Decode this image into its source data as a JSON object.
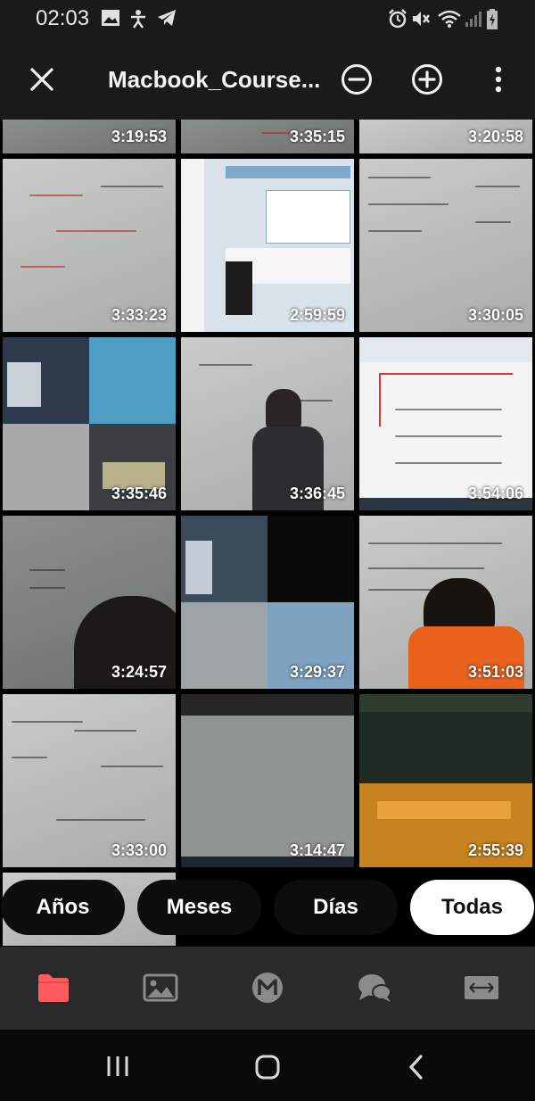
{
  "status_bar": {
    "time": "02:03",
    "left_icons": [
      "gallery-icon",
      "accessibility-icon",
      "telegram-icon"
    ],
    "right_icons": [
      "alarm-icon",
      "mute-icon",
      "wifi-icon",
      "signal-icon",
      "battery-charging-icon"
    ]
  },
  "app_bar": {
    "title": "Macbook_Course..."
  },
  "thumbnails": [
    {
      "duration": "3:19:53"
    },
    {
      "duration": "3:35:15"
    },
    {
      "duration": "3:20:58"
    },
    {
      "duration": "3:33:23"
    },
    {
      "duration": "2:59:59"
    },
    {
      "duration": "3:30:05"
    },
    {
      "duration": "3:35:46"
    },
    {
      "duration": "3:36:45"
    },
    {
      "duration": "3:54:06"
    },
    {
      "duration": "3:24:57"
    },
    {
      "duration": "3:29:37"
    },
    {
      "duration": "3:51:03"
    },
    {
      "duration": "3:33:00"
    },
    {
      "duration": "3:14:47"
    },
    {
      "duration": "2:55:39"
    }
  ],
  "filters": {
    "years": "Años",
    "months": "Meses",
    "days": "Días",
    "all": "Todas",
    "selected": "Todas"
  },
  "bottom_nav": [
    "folder-icon",
    "image-icon",
    "m-icon",
    "chat-icon",
    "fit-width-icon"
  ],
  "accent": "#ff5a5f"
}
